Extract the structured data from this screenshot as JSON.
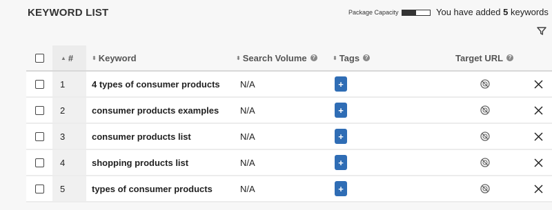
{
  "header": {
    "title": "KEYWORD LIST",
    "capacity_label": "Package Capacity",
    "capacity_fraction": 0.5,
    "added_prefix": "You have added",
    "added_count": "5",
    "added_suffix": "keywords"
  },
  "table": {
    "columns": {
      "num": "#",
      "keyword": "Keyword",
      "search_volume": "Search Volume",
      "tags": "Tags",
      "target_url": "Target URL"
    },
    "rows": [
      {
        "num": "1",
        "keyword": "4 types of consumer products",
        "search_volume": "N/A",
        "tag_label": "+"
      },
      {
        "num": "2",
        "keyword": "consumer products examples",
        "search_volume": "N/A",
        "tag_label": "+"
      },
      {
        "num": "3",
        "keyword": "consumer products list",
        "search_volume": "N/A",
        "tag_label": "+"
      },
      {
        "num": "4",
        "keyword": "shopping products list",
        "search_volume": "N/A",
        "tag_label": "+"
      },
      {
        "num": "5",
        "keyword": "types of consumer products",
        "search_volume": "N/A",
        "tag_label": "+"
      }
    ]
  },
  "colors": {
    "tag_button": "#2f6db5",
    "capacity_fill": "#333333"
  }
}
